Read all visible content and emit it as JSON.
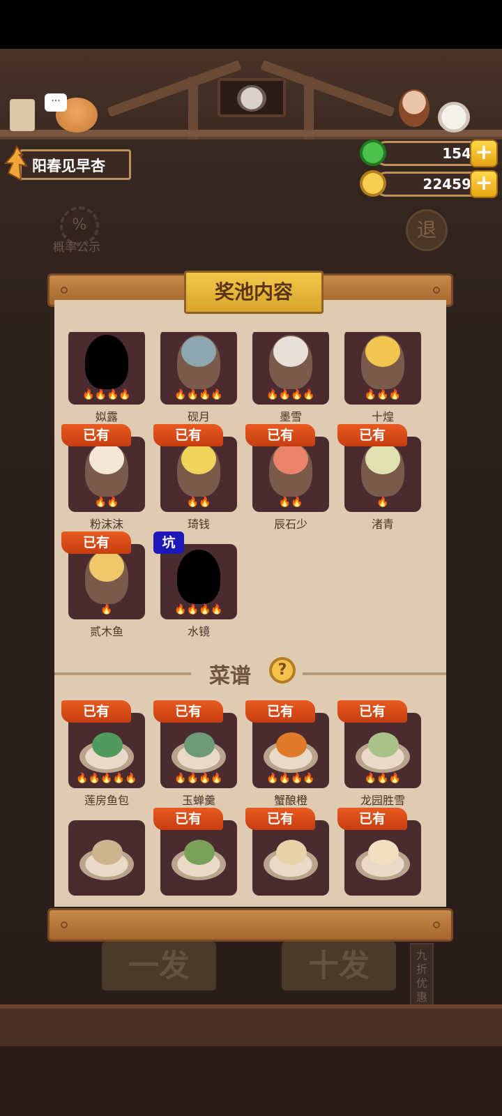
{
  "player": {
    "name": "阳春见早杏"
  },
  "currencies": {
    "gems": {
      "value": "154",
      "icon": "leaf-coin-icon",
      "plus": "+"
    },
    "coins": {
      "value": "22459",
      "icon": "gold-coin-icon",
      "plus": "+"
    }
  },
  "background": {
    "rate_label": "概率公示",
    "rate_icon": "%",
    "back_label": "退",
    "single_draw": "一发",
    "ten_draw": "十发",
    "discount": "九折优惠",
    "chat_icon": "···"
  },
  "panel": {
    "title": "奖池内容",
    "owned_label": "已有",
    "pit_label": "坑",
    "characters": [
      {
        "name": "姒露",
        "owned": false,
        "pit": false,
        "flames": "🔥🔥🔥🔥",
        "silhouette": true,
        "color": "#000000"
      },
      {
        "name": "砚月",
        "owned": false,
        "pit": false,
        "flames": "🔥🔥🔥🔥",
        "silhouette": false,
        "color": "#8ea6b0"
      },
      {
        "name": "墨雪",
        "owned": false,
        "pit": false,
        "flames": "🔥🔥🔥🔥",
        "silhouette": false,
        "color": "#e6e0d6"
      },
      {
        "name": "十煌",
        "owned": false,
        "pit": false,
        "flames": "🔥🔥🔥",
        "silhouette": false,
        "color": "#f2c450"
      },
      {
        "name": "粉沫沫",
        "owned": true,
        "pit": false,
        "flames": "🔥🔥",
        "silhouette": false,
        "color": "#f2e6d6"
      },
      {
        "name": "琦钱",
        "owned": true,
        "pit": false,
        "flames": "🔥🔥",
        "silhouette": false,
        "color": "#f0d35a"
      },
      {
        "name": "辰石少",
        "owned": true,
        "pit": false,
        "flames": "🔥🔥",
        "silhouette": false,
        "color": "#e9846a"
      },
      {
        "name": "渚青",
        "owned": true,
        "pit": false,
        "flames": "🔥",
        "silhouette": false,
        "color": "#dfe2b0"
      },
      {
        "name": "贰木鱼",
        "owned": true,
        "pit": false,
        "flames": "🔥",
        "silhouette": false,
        "color": "#f0c86a"
      },
      {
        "name": "水镜",
        "owned": false,
        "pit": true,
        "flames": "🔥🔥🔥🔥",
        "silhouette": true,
        "color": "#000000"
      }
    ],
    "recipe_section": {
      "title": "菜谱",
      "help": "?"
    },
    "recipes": [
      {
        "name": "莲房鱼包",
        "owned": true,
        "flames": "🔥🔥🔥🔥🔥",
        "color": "#4f9a5c"
      },
      {
        "name": "玉蝉羹",
        "owned": true,
        "flames": "🔥🔥🔥🔥",
        "color": "#6f9a7a"
      },
      {
        "name": "蟹酿橙",
        "owned": true,
        "flames": "🔥🔥🔥🔥",
        "color": "#e07a2a"
      },
      {
        "name": "龙园胜雪",
        "owned": true,
        "flames": "🔥🔥🔥",
        "color": "#a9c28a"
      },
      {
        "name": "",
        "owned": false,
        "flames": "",
        "color": "#cdb38e"
      },
      {
        "name": "",
        "owned": true,
        "flames": "",
        "color": "#7aa05a"
      },
      {
        "name": "",
        "owned": true,
        "flames": "",
        "color": "#e8d2a8"
      },
      {
        "name": "",
        "owned": true,
        "flames": "",
        "color": "#f2e0c0"
      }
    ]
  }
}
